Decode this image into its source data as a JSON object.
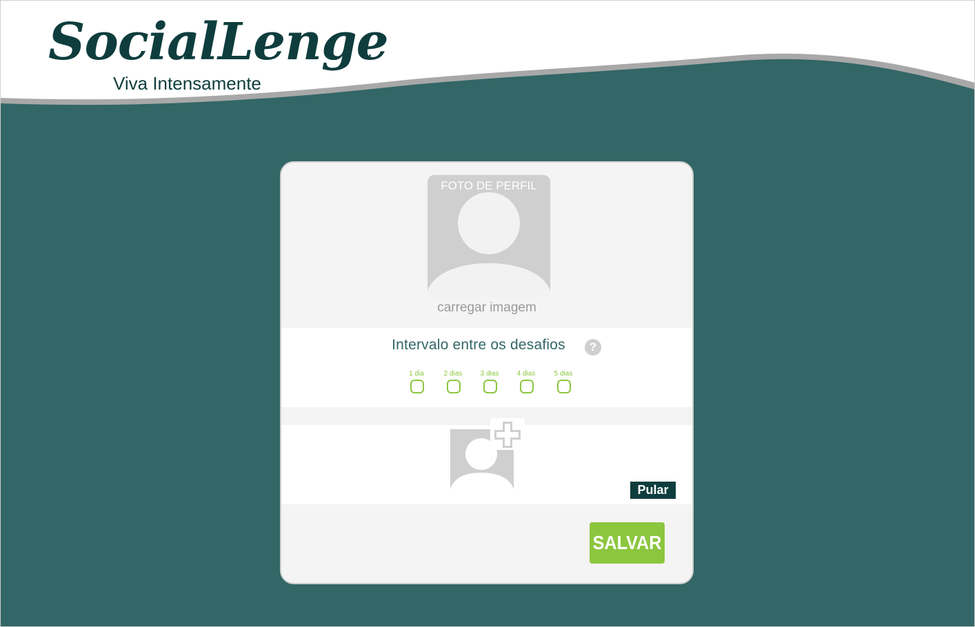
{
  "brand": {
    "name": "SocialLenge",
    "dots": "...",
    "tagline": "Viva Intensamente"
  },
  "profile": {
    "photo_label": "FOTO DE PERFIL",
    "upload_link": "carregar imagem"
  },
  "interval": {
    "title": "Intervalo entre os desafios",
    "help_icon": "?",
    "options": [
      {
        "label": "1 dia"
      },
      {
        "label": "2 dias"
      },
      {
        "label": "3 dias"
      },
      {
        "label": "4 dias"
      },
      {
        "label": "5 dias"
      }
    ]
  },
  "friends": {
    "icon": "add-user-photo-icon",
    "skip_label": "Pular"
  },
  "actions": {
    "save_label": "SALVAR"
  },
  "colors": {
    "background": "#336666",
    "brand_dark": "#0f3d3d",
    "accent_green": "#8cc63f",
    "placeholder_gray": "#cfcfcf",
    "card_bg": "#f4f4f4"
  }
}
